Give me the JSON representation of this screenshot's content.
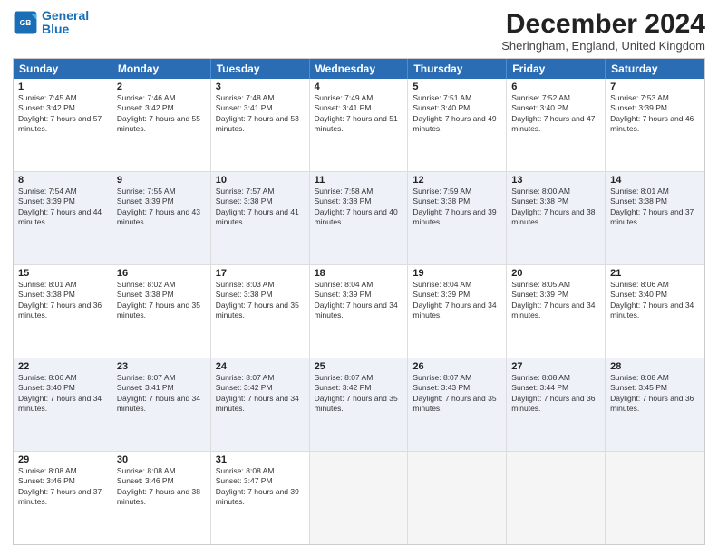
{
  "logo": {
    "line1": "General",
    "line2": "Blue"
  },
  "title": "December 2024",
  "subtitle": "Sheringham, England, United Kingdom",
  "days": [
    "Sunday",
    "Monday",
    "Tuesday",
    "Wednesday",
    "Thursday",
    "Friday",
    "Saturday"
  ],
  "weeks": [
    [
      {
        "day": "1",
        "sunrise": "7:45 AM",
        "sunset": "3:42 PM",
        "daylight": "7 hours and 57 minutes."
      },
      {
        "day": "2",
        "sunrise": "7:46 AM",
        "sunset": "3:42 PM",
        "daylight": "7 hours and 55 minutes."
      },
      {
        "day": "3",
        "sunrise": "7:48 AM",
        "sunset": "3:41 PM",
        "daylight": "7 hours and 53 minutes."
      },
      {
        "day": "4",
        "sunrise": "7:49 AM",
        "sunset": "3:41 PM",
        "daylight": "7 hours and 51 minutes."
      },
      {
        "day": "5",
        "sunrise": "7:51 AM",
        "sunset": "3:40 PM",
        "daylight": "7 hours and 49 minutes."
      },
      {
        "day": "6",
        "sunrise": "7:52 AM",
        "sunset": "3:40 PM",
        "daylight": "7 hours and 47 minutes."
      },
      {
        "day": "7",
        "sunrise": "7:53 AM",
        "sunset": "3:39 PM",
        "daylight": "7 hours and 46 minutes."
      }
    ],
    [
      {
        "day": "8",
        "sunrise": "7:54 AM",
        "sunset": "3:39 PM",
        "daylight": "7 hours and 44 minutes."
      },
      {
        "day": "9",
        "sunrise": "7:55 AM",
        "sunset": "3:39 PM",
        "daylight": "7 hours and 43 minutes."
      },
      {
        "day": "10",
        "sunrise": "7:57 AM",
        "sunset": "3:38 PM",
        "daylight": "7 hours and 41 minutes."
      },
      {
        "day": "11",
        "sunrise": "7:58 AM",
        "sunset": "3:38 PM",
        "daylight": "7 hours and 40 minutes."
      },
      {
        "day": "12",
        "sunrise": "7:59 AM",
        "sunset": "3:38 PM",
        "daylight": "7 hours and 39 minutes."
      },
      {
        "day": "13",
        "sunrise": "8:00 AM",
        "sunset": "3:38 PM",
        "daylight": "7 hours and 38 minutes."
      },
      {
        "day": "14",
        "sunrise": "8:01 AM",
        "sunset": "3:38 PM",
        "daylight": "7 hours and 37 minutes."
      }
    ],
    [
      {
        "day": "15",
        "sunrise": "8:01 AM",
        "sunset": "3:38 PM",
        "daylight": "7 hours and 36 minutes."
      },
      {
        "day": "16",
        "sunrise": "8:02 AM",
        "sunset": "3:38 PM",
        "daylight": "7 hours and 35 minutes."
      },
      {
        "day": "17",
        "sunrise": "8:03 AM",
        "sunset": "3:38 PM",
        "daylight": "7 hours and 35 minutes."
      },
      {
        "day": "18",
        "sunrise": "8:04 AM",
        "sunset": "3:39 PM",
        "daylight": "7 hours and 34 minutes."
      },
      {
        "day": "19",
        "sunrise": "8:04 AM",
        "sunset": "3:39 PM",
        "daylight": "7 hours and 34 minutes."
      },
      {
        "day": "20",
        "sunrise": "8:05 AM",
        "sunset": "3:39 PM",
        "daylight": "7 hours and 34 minutes."
      },
      {
        "day": "21",
        "sunrise": "8:06 AM",
        "sunset": "3:40 PM",
        "daylight": "7 hours and 34 minutes."
      }
    ],
    [
      {
        "day": "22",
        "sunrise": "8:06 AM",
        "sunset": "3:40 PM",
        "daylight": "7 hours and 34 minutes."
      },
      {
        "day": "23",
        "sunrise": "8:07 AM",
        "sunset": "3:41 PM",
        "daylight": "7 hours and 34 minutes."
      },
      {
        "day": "24",
        "sunrise": "8:07 AM",
        "sunset": "3:42 PM",
        "daylight": "7 hours and 34 minutes."
      },
      {
        "day": "25",
        "sunrise": "8:07 AM",
        "sunset": "3:42 PM",
        "daylight": "7 hours and 35 minutes."
      },
      {
        "day": "26",
        "sunrise": "8:07 AM",
        "sunset": "3:43 PM",
        "daylight": "7 hours and 35 minutes."
      },
      {
        "day": "27",
        "sunrise": "8:08 AM",
        "sunset": "3:44 PM",
        "daylight": "7 hours and 36 minutes."
      },
      {
        "day": "28",
        "sunrise": "8:08 AM",
        "sunset": "3:45 PM",
        "daylight": "7 hours and 36 minutes."
      }
    ],
    [
      {
        "day": "29",
        "sunrise": "8:08 AM",
        "sunset": "3:46 PM",
        "daylight": "7 hours and 37 minutes."
      },
      {
        "day": "30",
        "sunrise": "8:08 AM",
        "sunset": "3:46 PM",
        "daylight": "7 hours and 38 minutes."
      },
      {
        "day": "31",
        "sunrise": "8:08 AM",
        "sunset": "3:47 PM",
        "daylight": "7 hours and 39 minutes."
      },
      null,
      null,
      null,
      null
    ]
  ],
  "labels": {
    "sunrise": "Sunrise:",
    "sunset": "Sunset:",
    "daylight": "Daylight:"
  }
}
